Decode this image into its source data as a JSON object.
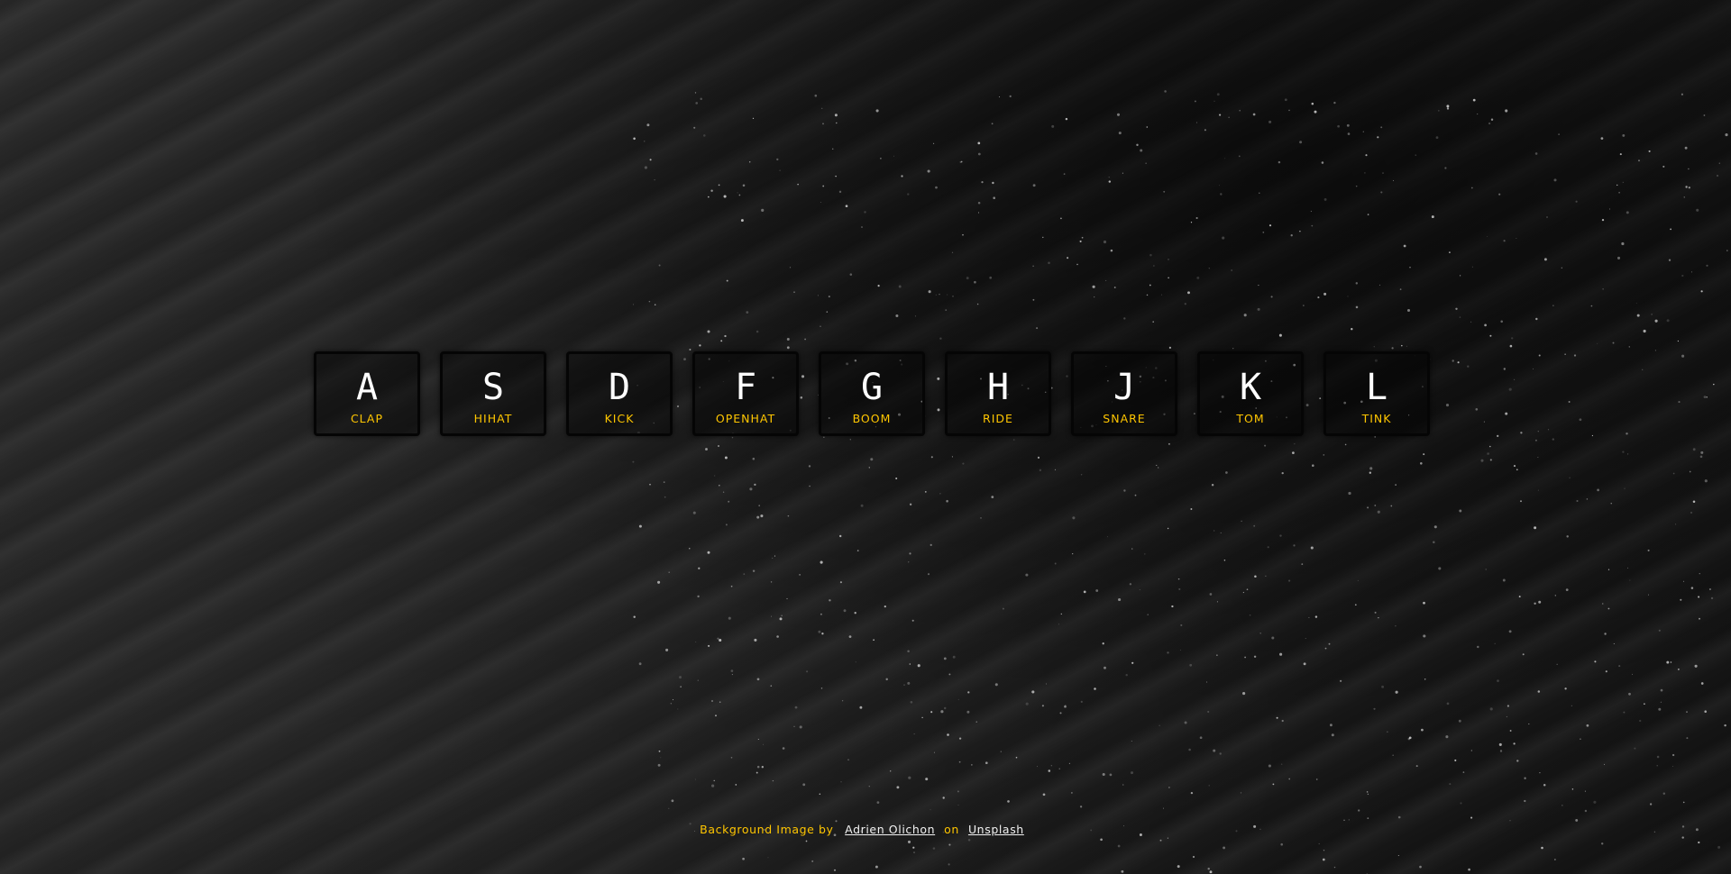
{
  "background": {
    "description_color": "#1a1a1a"
  },
  "accent_color": "#ffc600",
  "keys": [
    {
      "letter": "A",
      "sound": "CLAP"
    },
    {
      "letter": "S",
      "sound": "HIHAT"
    },
    {
      "letter": "D",
      "sound": "KICK"
    },
    {
      "letter": "F",
      "sound": "OPENHAT"
    },
    {
      "letter": "G",
      "sound": "BOOM"
    },
    {
      "letter": "H",
      "sound": "RIDE"
    },
    {
      "letter": "J",
      "sound": "SNARE"
    },
    {
      "letter": "K",
      "sound": "TOM"
    },
    {
      "letter": "L",
      "sound": "TINK"
    }
  ],
  "credit": {
    "prefix": "Background Image by",
    "author": "Adrien Olichon",
    "connector": "on",
    "source": "Unsplash"
  }
}
